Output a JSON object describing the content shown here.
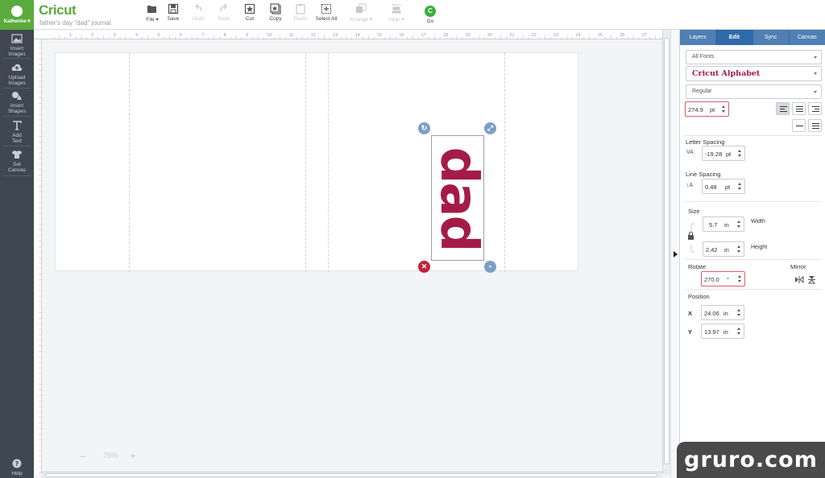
{
  "sidebar": {
    "user": "Katherine",
    "items": [
      {
        "label_1": "Insert",
        "label_2": "Images"
      },
      {
        "label_1": "Upload",
        "label_2": "Images"
      },
      {
        "label_1": "Insert",
        "label_2": "Shapes"
      },
      {
        "label_1": "Add",
        "label_2": "Text"
      },
      {
        "label_1": "Set",
        "label_2": "Canvas"
      }
    ],
    "help": "Help"
  },
  "header": {
    "logo": "Cricut",
    "project_name": "father's day \"dad\" journal",
    "tools": {
      "file": "File",
      "save": "Save",
      "undo": "Undo",
      "redo": "Redo",
      "cut": "Cut",
      "copy": "Copy",
      "paste": "Paste",
      "select_all": "Select All",
      "arrange": "Arrange",
      "align": "Align",
      "go": "Go",
      "go_letter": "C"
    }
  },
  "ruler": {
    "top_labels": [
      "1",
      "2",
      "3",
      "4",
      "5",
      "6",
      "7",
      "8",
      "9",
      "10",
      "11",
      "12",
      "13",
      "14",
      "15",
      "16",
      "17",
      "18",
      "19",
      "20",
      "21",
      "22",
      "23",
      "24",
      "25",
      "26",
      "27",
      "28"
    ]
  },
  "canvas": {
    "text": "dad",
    "text_color": "#a51b48"
  },
  "zoom": {
    "minus": "−",
    "value": "75%",
    "plus": "+"
  },
  "panel": {
    "tabs": [
      "Layers",
      "Edit",
      "Sync",
      "Canvas"
    ],
    "active_tab": "Edit",
    "font_filter": "All Fonts",
    "font": "Cricut Alphabet",
    "style": "Regular",
    "font_size": {
      "value": "274.9",
      "unit": "pt"
    },
    "letter_spacing": {
      "label": "Letter Spacing",
      "value": "-19.28",
      "unit": "pt"
    },
    "line_spacing": {
      "label": "Line Spacing",
      "value": "0.48",
      "unit": "pt"
    },
    "size": {
      "label": "Size",
      "width": {
        "value": "5.7",
        "unit": "in",
        "label": "Width"
      },
      "height": {
        "value": "2.42",
        "unit": "in",
        "label": "Height"
      }
    },
    "rotate": {
      "label": "Rotate",
      "value": "270.0",
      "unit": "°"
    },
    "mirror": {
      "label": "Mirror"
    },
    "position": {
      "label": "Position",
      "x": {
        "axis": "X",
        "value": "24.06",
        "unit": "in"
      },
      "y": {
        "axis": "Y",
        "value": "13.97",
        "unit": "in"
      }
    }
  },
  "watermark": "gruro.com"
}
